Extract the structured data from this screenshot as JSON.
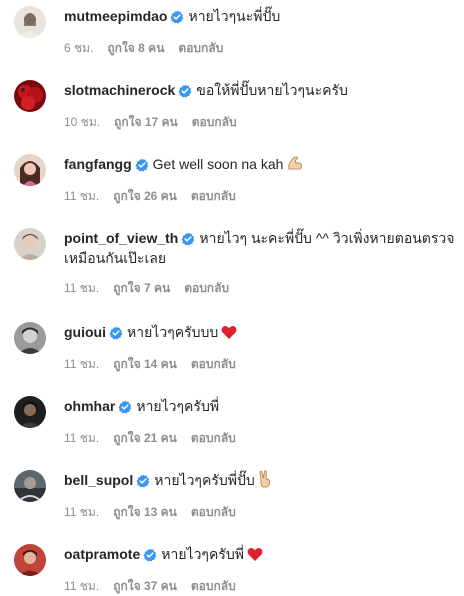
{
  "comments": [
    {
      "username": "mutmeepimdao",
      "text": "หายไวๆนะพี่ปั๊บ",
      "emoji": "",
      "time": "6 ชม.",
      "likes": "ถูกใจ 8 คน",
      "reply": "ตอบกลับ",
      "avatar_color": "#d9d2c8"
    },
    {
      "username": "slotmachinerock",
      "text": "ขอให้พี่ปั๊บหายไวๆนะครับ",
      "emoji": "",
      "time": "10 ชม.",
      "likes": "ถูกใจ 17 คน",
      "reply": "ตอบกลับ",
      "avatar_color": "#b3121a"
    },
    {
      "username": "fangfangg",
      "text": "Get well soon na kah",
      "emoji": "muscle-arm",
      "time": "11 ชม.",
      "likes": "ถูกใจ 26 คน",
      "reply": "ตอบกลับ",
      "avatar_color": "#7a4a3a"
    },
    {
      "username": "point_of_view_th",
      "text": "หายไวๆ นะคะพี่ปั๊บ ^^ วิวเพิ่งหายตอนตรวจเหมือนกันเป๊ะเลย",
      "emoji": "",
      "time": "11 ชม.",
      "likes": "ถูกใจ 7 คน",
      "reply": "ตอบกลับ",
      "avatar_color": "#cfc9c1"
    },
    {
      "username": "guioui",
      "text": "หายไวๆครับบบ",
      "emoji": "red-heart",
      "time": "11 ชม.",
      "likes": "ถูกใจ 14 คน",
      "reply": "ตอบกลับ",
      "avatar_color": "#6f6f6f"
    },
    {
      "username": "ohmhar",
      "text": "หายไวๆครับพี่",
      "emoji": "",
      "time": "11 ชม.",
      "likes": "ถูกใจ 21 คน",
      "reply": "ตอบกลับ",
      "avatar_color": "#2f2f2f"
    },
    {
      "username": "bell_supol",
      "text": "หายไวๆครับพี่ปั๊บ",
      "emoji": "victory-hand",
      "time": "11 ชม.",
      "likes": "ถูกใจ 13 คน",
      "reply": "ตอบกลับ",
      "avatar_color": "#4a5560"
    },
    {
      "username": "oatpramote",
      "text": "หายไวๆครับพี่",
      "emoji": "red-heart",
      "time": "11 ชม.",
      "likes": "ถูกใจ 37 คน",
      "reply": "ตอบกลับ",
      "avatar_color": "#c0443a"
    }
  ],
  "colors": {
    "verified": "#3897f0",
    "meta": "#8e8e8e",
    "text": "#262626"
  }
}
